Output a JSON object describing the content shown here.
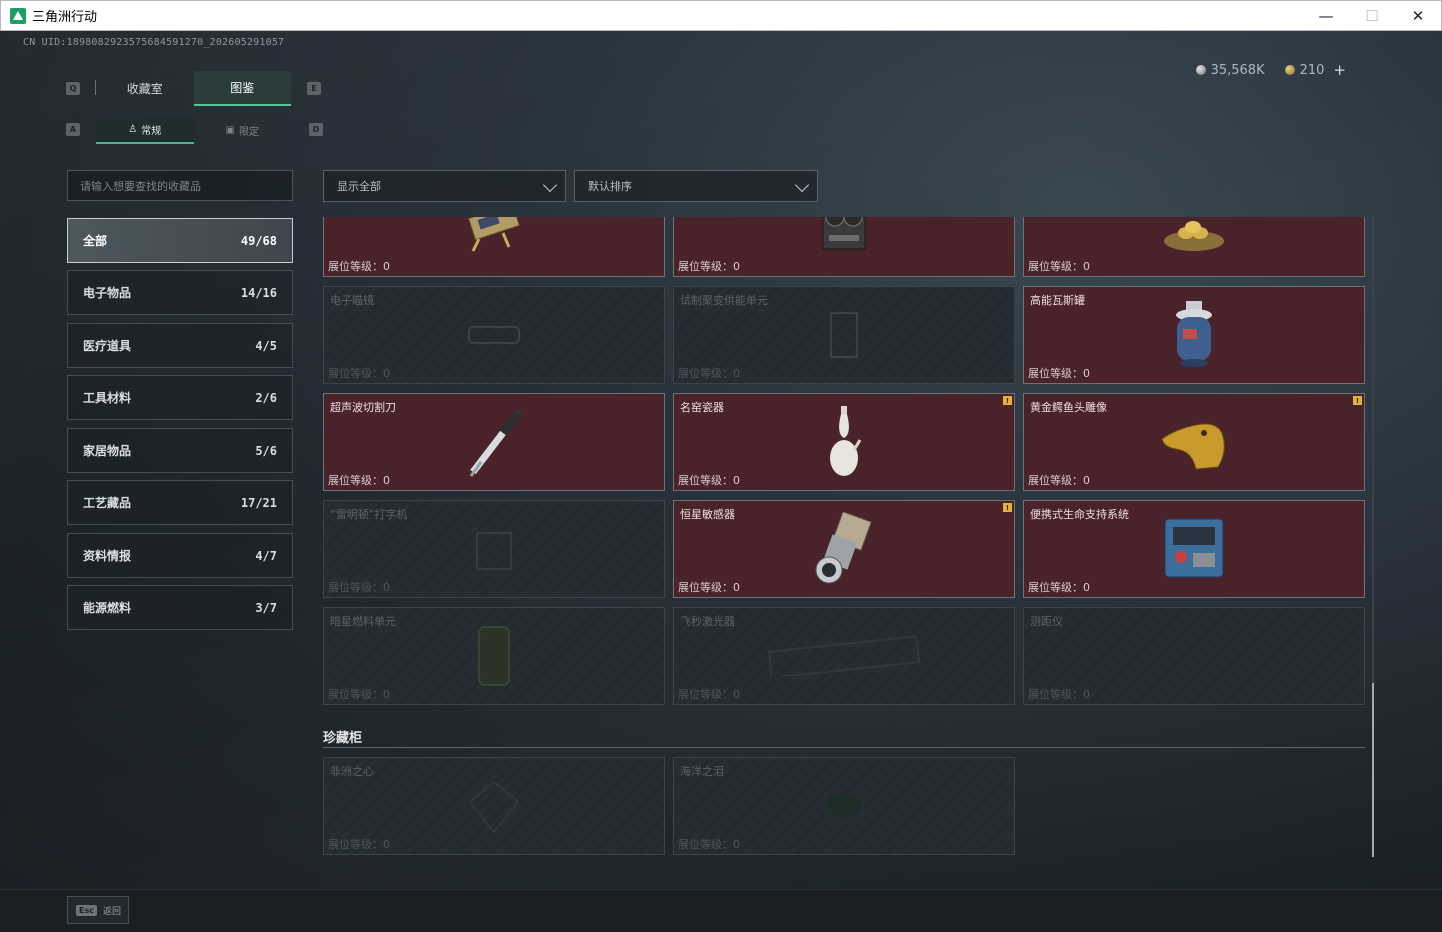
{
  "window": {
    "title": "三角洲行动",
    "min": "—",
    "max": "☐",
    "close": "✕"
  },
  "uid": "CN UID:1898082923575684591270_202605291057",
  "currency": {
    "silver": "35,568K",
    "gold": "210",
    "plus": "+"
  },
  "keys": {
    "q": "Q",
    "e": "E",
    "a": "A",
    "d": "D"
  },
  "tabs": [
    {
      "label": "收藏室"
    },
    {
      "label": "图鉴"
    }
  ],
  "subtabs": [
    {
      "label": "常规"
    },
    {
      "label": "限定"
    }
  ],
  "search": {
    "placeholder": "请输入想要查找的收藏品"
  },
  "filters": {
    "show": "显示全部",
    "sort": "默认排序"
  },
  "categories": [
    {
      "label": "全部",
      "count": "49/68"
    },
    {
      "label": "电子物品",
      "count": "14/16"
    },
    {
      "label": "医疗道具",
      "count": "4/5"
    },
    {
      "label": "工具材料",
      "count": "2/6"
    },
    {
      "label": "家居物品",
      "count": "5/6"
    },
    {
      "label": "工艺藏品",
      "count": "17/21"
    },
    {
      "label": "资料情报",
      "count": "4/7"
    },
    {
      "label": "能源燃料",
      "count": "3/7"
    }
  ],
  "level_label": "展位等级：0",
  "items": [
    {
      "name": "",
      "icon": "circuit-device-icon"
    },
    {
      "name": "",
      "icon": "tape-recorder-icon"
    },
    {
      "name": "",
      "icon": "golden-eggs-nest-icon"
    },
    {
      "name": "电子瞄镜",
      "icon": "scope-icon"
    },
    {
      "name": "试制聚变供能单元",
      "icon": "fusion-unit-icon"
    },
    {
      "name": "高能瓦斯罐",
      "icon": "gas-canister-icon"
    },
    {
      "name": "超声波切割刀",
      "icon": "ultrasonic-blade-icon"
    },
    {
      "name": "名窑瓷器",
      "icon": "porcelain-vase-icon",
      "flag": "!"
    },
    {
      "name": "黄金鳄鱼头雕像",
      "icon": "golden-croc-icon",
      "flag": "!"
    },
    {
      "name": "“雷明顿”打字机",
      "icon": "typewriter-icon"
    },
    {
      "name": "恒星敏感器",
      "icon": "star-sensor-icon",
      "flag": "!"
    },
    {
      "name": "便携式生命支持系统",
      "icon": "life-support-icon"
    },
    {
      "name": "暗星燃料单元",
      "icon": "fuel-cell-icon"
    },
    {
      "name": "飞秒激光器",
      "icon": "laser-icon"
    },
    {
      "name": "测距仪",
      "icon": "rangefinder-icon"
    }
  ],
  "section": {
    "title": "珍藏柜"
  },
  "treasures": [
    {
      "name": "非洲之心",
      "icon": "diamond-icon"
    },
    {
      "name": "海洋之泪",
      "icon": "gem-icon"
    }
  ],
  "footer": {
    "esc": "Esc",
    "back": "返回"
  }
}
